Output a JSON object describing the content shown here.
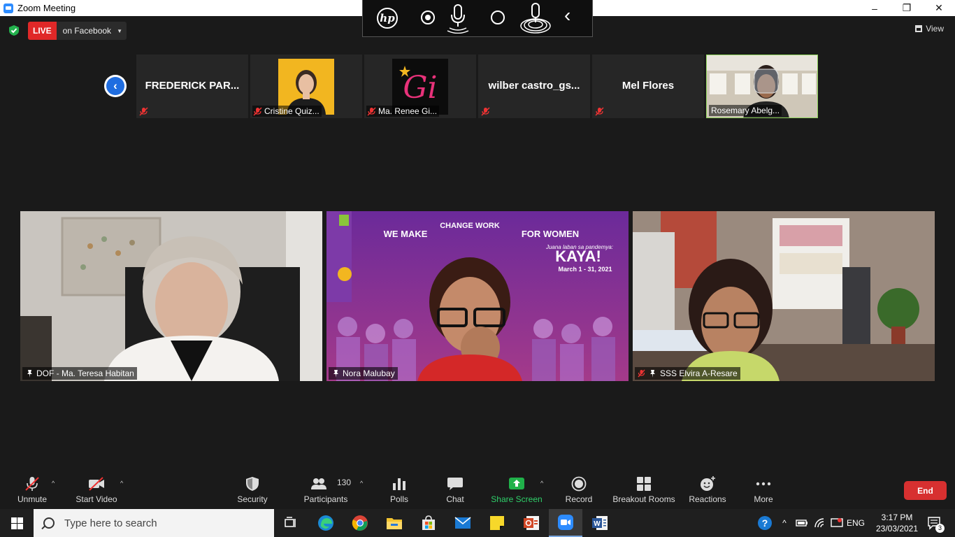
{
  "window": {
    "title": "Zoom Meeting",
    "minimize": "–",
    "maximize": "❐",
    "close": "✕"
  },
  "status": {
    "live_label": "LIVE",
    "live_target": "on Facebook",
    "view_label": "View"
  },
  "gallery_thumbs": [
    {
      "name": "FREDERICK  PAR...",
      "muted": true
    },
    {
      "name": "Cristine Quiz...",
      "muted": true
    },
    {
      "name": "Ma. Renee Gi...",
      "muted": true,
      "logo_text": "Gi"
    },
    {
      "name": "wilber  castro_gs...",
      "muted": true
    },
    {
      "name": "Mel Flores",
      "muted": true
    },
    {
      "name": "Rosemary Abelg...",
      "muted": false
    }
  ],
  "video_tiles": [
    {
      "name": "DOF - Ma. Teresa Habitan",
      "pinned": true
    },
    {
      "name": "Nora Malubay",
      "pinned": true,
      "banner": {
        "line1": "WE MAKE",
        "line2": "CHANGE WORK",
        "line3": "FOR WOMEN",
        "line4": "Juana laban sa pandemya:",
        "kaya": "KAYA!",
        "dates": "March 1 - 31, 2021"
      }
    },
    {
      "name": "SSS Elvira A-Resare",
      "muted": true
    }
  ],
  "toolbar": {
    "unmute": "Unmute",
    "start_video": "Start Video",
    "security": "Security",
    "participants": "Participants",
    "participants_count": "130",
    "polls": "Polls",
    "chat": "Chat",
    "share_screen": "Share Screen",
    "record": "Record",
    "breakout_rooms": "Breakout Rooms",
    "reactions": "Reactions",
    "more": "More",
    "end": "End"
  },
  "taskbar": {
    "search_placeholder": "Type here to search",
    "language": "ENG",
    "time": "3:17 PM",
    "date": "23/03/2021",
    "notifications": "3"
  },
  "colors": {
    "accent": "#2d8cff",
    "live": "#e02828",
    "end": "#d73030",
    "share": "#20b14a"
  }
}
